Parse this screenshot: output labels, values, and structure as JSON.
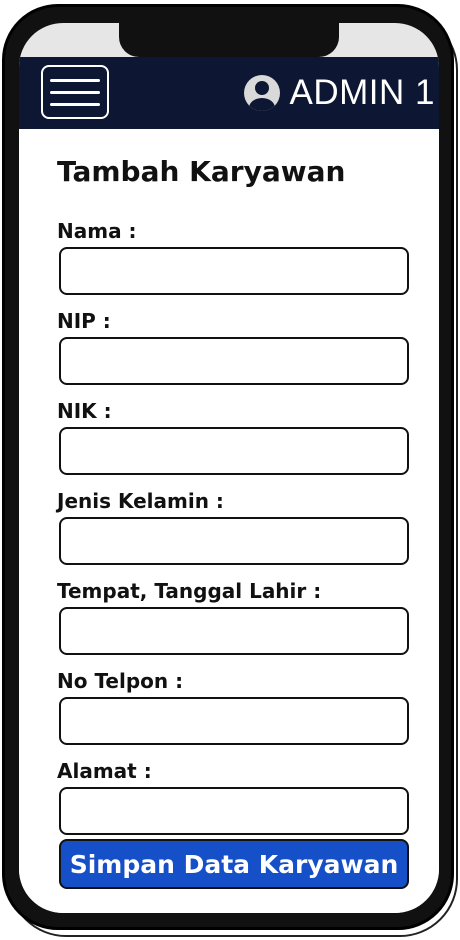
{
  "header": {
    "admin_name": "ADMIN 1"
  },
  "form": {
    "title": "Tambah Karyawan",
    "fields": [
      {
        "label": "Nama :",
        "value": "",
        "placeholder": ""
      },
      {
        "label": "NIP :",
        "value": "",
        "placeholder": ""
      },
      {
        "label": "NIK :",
        "value": "",
        "placeholder": ""
      },
      {
        "label": "Jenis Kelamin :",
        "value": "",
        "placeholder": ""
      },
      {
        "label": "Tempat, Tanggal Lahir :",
        "value": "",
        "placeholder": ""
      },
      {
        "label": "No Telpon :",
        "value": "",
        "placeholder": ""
      },
      {
        "label": "Alamat :",
        "value": "",
        "placeholder": ""
      }
    ],
    "submit_label": "Simpan Data Karyawan"
  },
  "icons": {
    "menu": "hamburger-menu-icon",
    "user": "user-avatar-icon"
  },
  "colors": {
    "app_bar": "#0d1733",
    "submit_button": "#1550c8",
    "text_dark": "#111111",
    "on_dark": "#ffffff"
  }
}
